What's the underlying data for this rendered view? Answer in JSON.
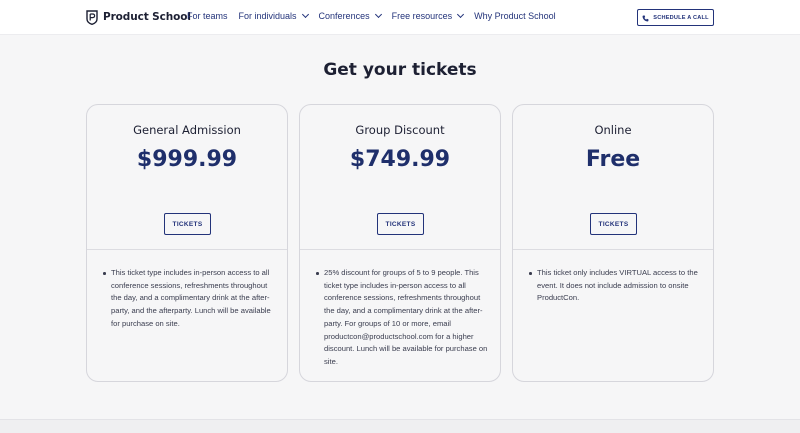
{
  "brand": {
    "name": "Product School",
    "logo_icon": "shield-logo-icon"
  },
  "nav": {
    "items": [
      {
        "label": "For teams",
        "has_dropdown": false
      },
      {
        "label": "For individuals",
        "has_dropdown": true
      },
      {
        "label": "Conferences",
        "has_dropdown": true
      },
      {
        "label": "Free resources",
        "has_dropdown": true
      },
      {
        "label": "Why Product School",
        "has_dropdown": false
      }
    ],
    "cta_label": "SCHEDULE A CALL",
    "cta_icon": "phone-icon"
  },
  "section": {
    "title": "Get your tickets"
  },
  "tickets": [
    {
      "name": "General Admission",
      "price": "$999.99",
      "button_label": "TICKETS",
      "description": "This ticket type includes in-person access to all conference sessions, refreshments throughout the day, and a complimentary drink at the after-party, and the afterparty. Lunch will be available for purchase on site."
    },
    {
      "name": "Group Discount",
      "price": "$749.99",
      "button_label": "TICKETS",
      "description": "25% discount for groups of 5 to 9 people. This ticket type includes in-person access to all conference sessions, refreshments throughout the day, and a complimentary drink at the after-party. For groups of 10 or more, email productcon@productschool.com for a higher discount. Lunch will be available for purchase on site."
    },
    {
      "name": "Online",
      "price": "Free",
      "button_label": "TICKETS",
      "description": "This ticket only includes VIRTUAL access to the event. It does not include admission to onsite ProductCon."
    }
  ],
  "colors": {
    "navy": "#23337a",
    "price": "#1f2f6b",
    "text": "#1d2033",
    "background": "#f6f6f7"
  }
}
